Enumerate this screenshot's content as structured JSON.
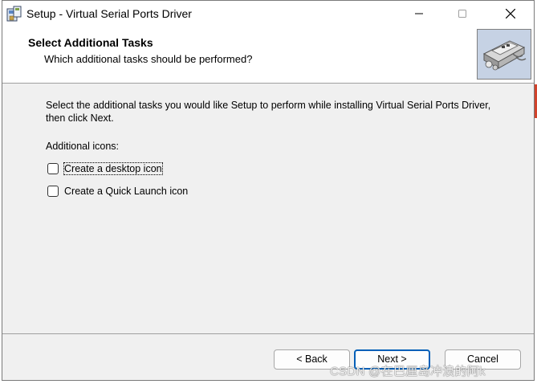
{
  "window": {
    "title": "Setup - Virtual Serial Ports Driver",
    "controls": {
      "minimize": "minimize-icon",
      "maximize": "maximize-icon",
      "close": "close-icon"
    }
  },
  "header": {
    "title": "Select Additional Tasks",
    "subtitle": "Which additional tasks should be performed?"
  },
  "body": {
    "description": "Select the additional tasks you would like Setup to perform while installing Virtual Serial Ports Driver, then click Next.",
    "group_label": "Additional icons:",
    "tasks": [
      {
        "label": "Create a desktop icon",
        "checked": false
      },
      {
        "label": "Create a Quick Launch icon",
        "checked": false
      }
    ]
  },
  "buttons": {
    "back": "< Back",
    "next": "Next >",
    "cancel": "Cancel"
  },
  "watermark": "CSDN @在巴厘岛冲浪的阿k",
  "colors": {
    "accent": "#005fb8",
    "panel": "#f0f0f0",
    "header_bg": "#ffffff"
  }
}
